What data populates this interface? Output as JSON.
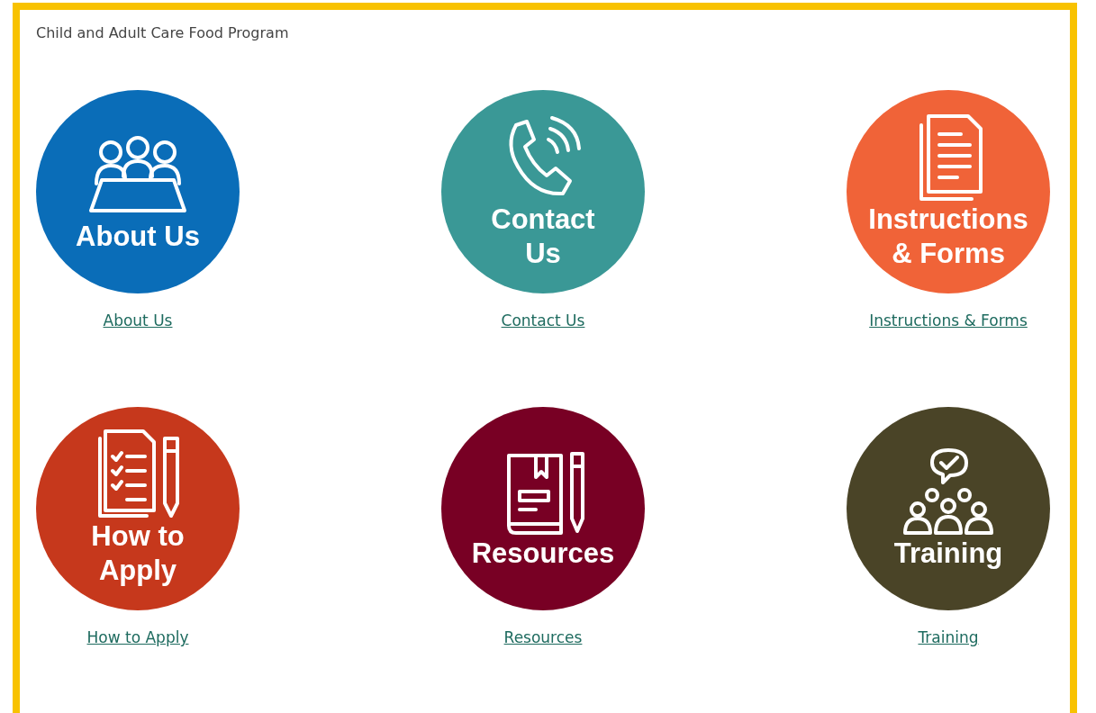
{
  "header": {
    "title": "Child and Adult Care Food Program"
  },
  "tiles": [
    {
      "kind": "meeting",
      "color": "#0a6db8",
      "circle_lines": [
        "About Us"
      ],
      "link": "About Us"
    },
    {
      "kind": "phone",
      "color": "#3a9896",
      "circle_lines": [
        "Contact",
        "Us"
      ],
      "link": "Contact Us"
    },
    {
      "kind": "document",
      "color": "#f06338",
      "circle_lines": [
        "Instructions",
        "& Forms"
      ],
      "link": "Instructions & Forms"
    },
    {
      "kind": "checklist",
      "color": "#c6381c",
      "circle_lines": [
        "How to",
        "Apply"
      ],
      "link": "How to Apply"
    },
    {
      "kind": "book",
      "color": "#780024",
      "circle_lines": [
        "Resources"
      ],
      "link": "Resources"
    },
    {
      "kind": "group",
      "color": "#4a4427",
      "circle_lines": [
        "Training"
      ],
      "link": "Training"
    }
  ]
}
